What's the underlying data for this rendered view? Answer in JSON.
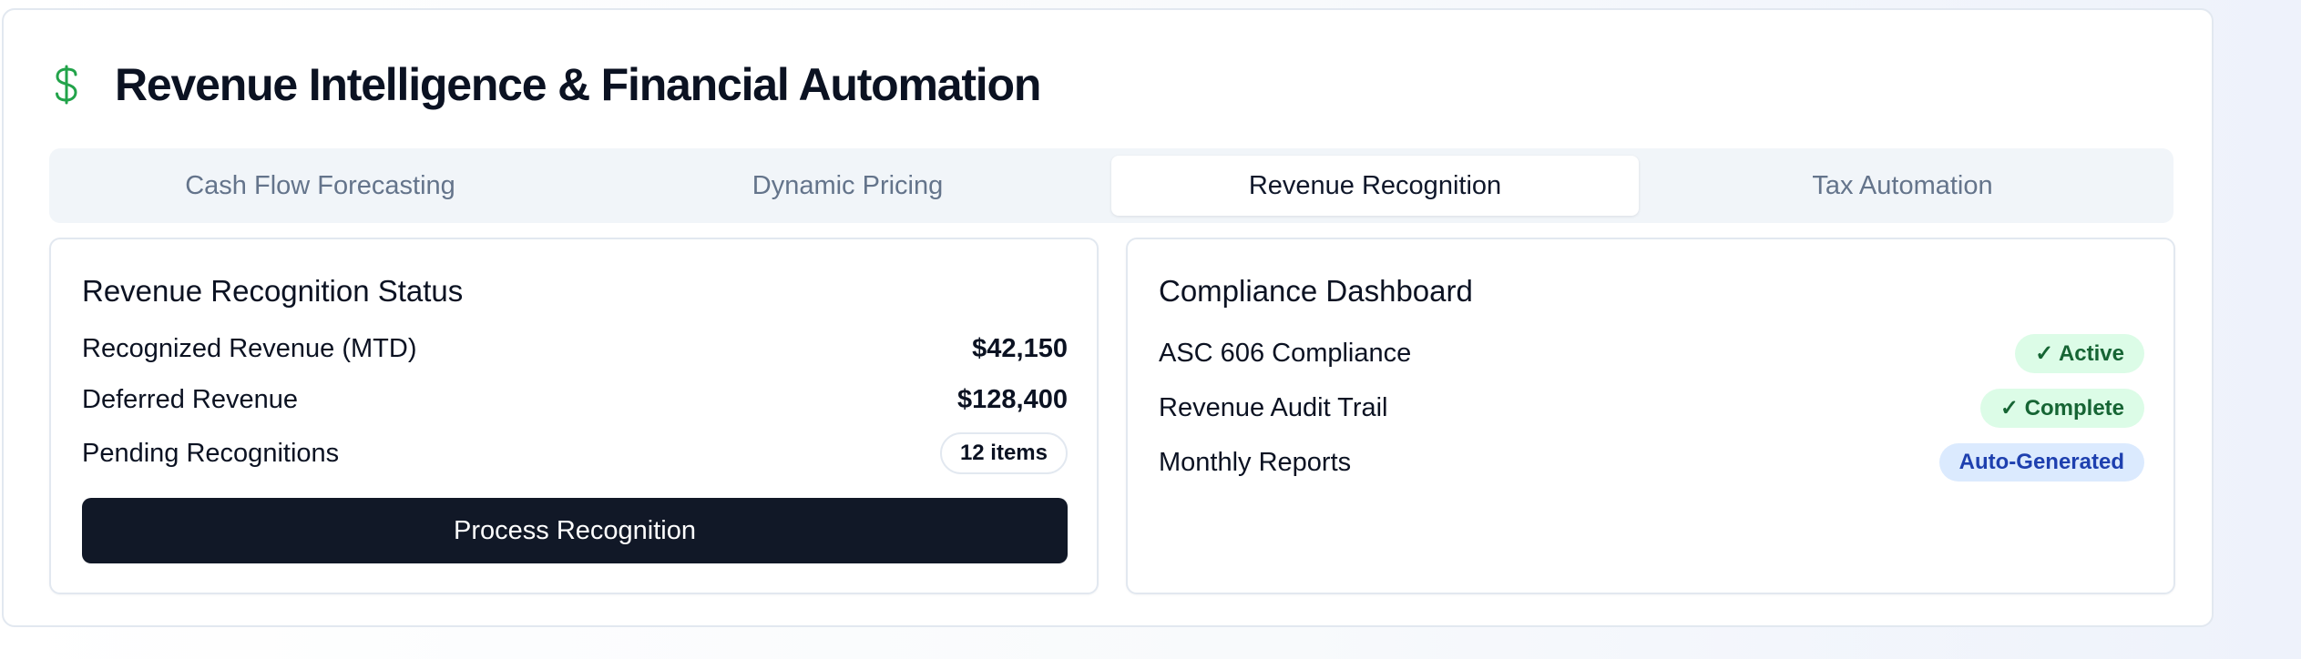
{
  "header": {
    "icon": "dollar-icon",
    "title": "Revenue Intelligence & Financial Automation"
  },
  "tabs": [
    {
      "label": "Cash Flow Forecasting",
      "active": false
    },
    {
      "label": "Dynamic Pricing",
      "active": false
    },
    {
      "label": "Revenue Recognition",
      "active": true
    },
    {
      "label": "Tax Automation",
      "active": false
    }
  ],
  "recognition": {
    "title": "Revenue Recognition Status",
    "rows": [
      {
        "label": "Recognized Revenue (MTD)",
        "value": "$42,150"
      },
      {
        "label": "Deferred Revenue",
        "value": "$128,400"
      },
      {
        "label": "Pending Recognitions",
        "value": "12 items"
      }
    ],
    "button_label": "Process Recognition"
  },
  "compliance": {
    "title": "Compliance Dashboard",
    "rows": [
      {
        "label": "ASC 606 Compliance",
        "badge": "✓ Active"
      },
      {
        "label": "Revenue Audit Trail",
        "badge": "✓ Complete"
      },
      {
        "label": "Monthly Reports",
        "badge": "Auto-Generated"
      }
    ]
  },
  "colors": {
    "accent_green": "#22a34a",
    "button_dark": "#111827",
    "badge_green_bg": "#dcfce7",
    "badge_green_text": "#166534",
    "badge_blue_bg": "#dbeafe",
    "badge_blue_text": "#1e40af"
  }
}
